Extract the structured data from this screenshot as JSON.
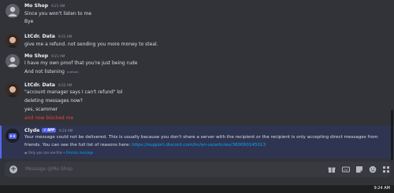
{
  "messages": [
    {
      "author": "Mo Shop",
      "time": "9:21 AM",
      "lines": [
        "Since you won't listen to me",
        "Bye"
      ]
    },
    {
      "author": "LtCdr. Data",
      "time": "9:21 AM",
      "lines": [
        "give me a refund. not sending you more money to steal."
      ]
    },
    {
      "author": "Mo Shop",
      "time": "9:21 AM",
      "lines": [
        "I have my own proof that you're just being rude",
        "And not listening"
      ],
      "edited": "(edited)"
    },
    {
      "author": "LtCdr. Data",
      "time": "9:22 AM",
      "lines": [
        "\"account manager says I can't refund\" lol",
        "deleting messages now?",
        "yes, scammer",
        "and now blocked me"
      ]
    }
  ],
  "clyde": {
    "author": "Clyde",
    "badge": "✔ APP",
    "time": "9:24 AM",
    "text1": "Your message could not be delivered. This is usually because you don't share a server with the recipient or the recipient is only accepting direct messages from",
    "text2": "friends. You can see the full list of reasons here: ",
    "link": "https://support.discord.com/hc/en-us/articles/360060145013",
    "ephemeral": "Only you can see this •",
    "dismiss": "Dismiss message"
  },
  "composer": {
    "placeholder": "Message @Mo Shop"
  },
  "taskbar": {
    "clock": "9:24 AM"
  },
  "colors": {
    "bg": "#313338",
    "accent": "#5865f2",
    "link": "#00a8fc",
    "danger": "#f23f43"
  }
}
